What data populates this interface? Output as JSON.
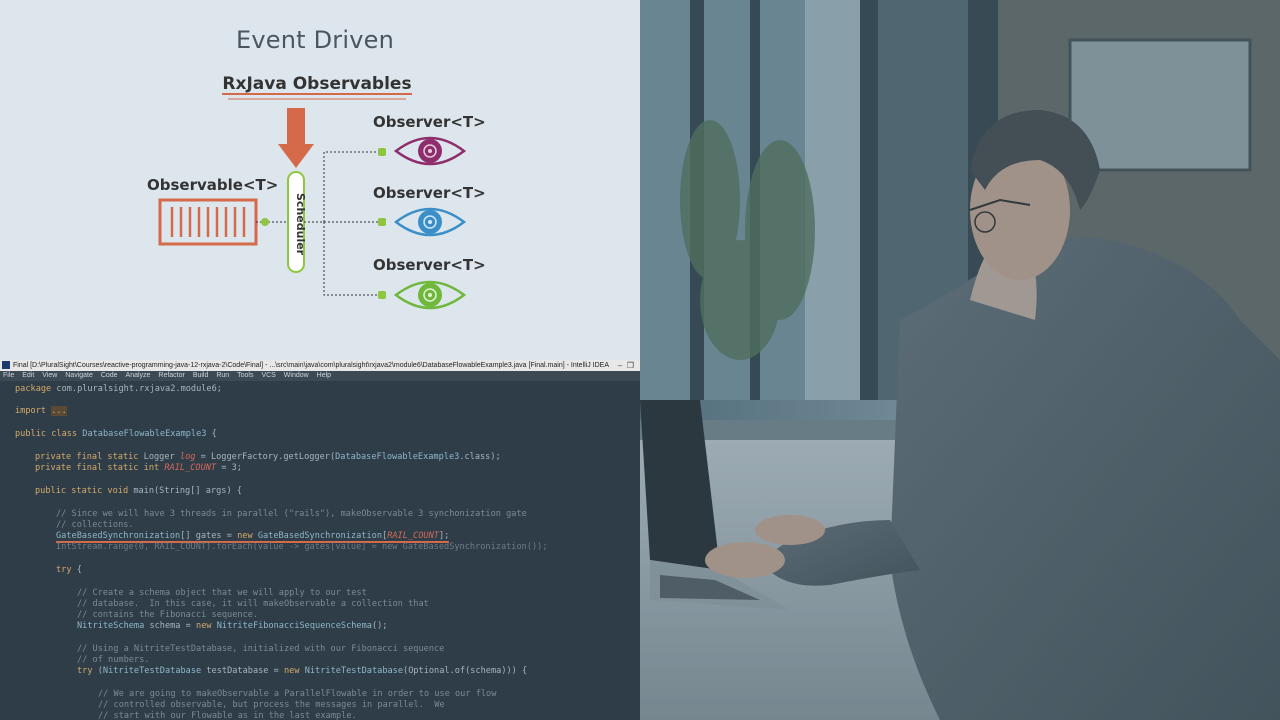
{
  "slide": {
    "title": "Event Driven",
    "subtitle": "RxJava Observables",
    "observable_label": "Observable<T>",
    "scheduler_label": "Scheduler",
    "observers": [
      "Observer<T>",
      "Observer<T>",
      "Observer<T>"
    ],
    "colors": {
      "arrow": "#d46a4a",
      "green": "#8ec63f",
      "purple": "#8e2d6b",
      "blue": "#3a8fc9",
      "green_eye": "#6fb83b"
    }
  },
  "ide": {
    "title": "Final [D:\\PluralSight\\Courses\\reactive-programming-java-12-rxjava-2\\Code\\Final] - ...\\src\\main\\java\\com\\pluralsight\\rxjava2\\module6\\DatabaseFlowableExample3.java [Final.main] - IntelliJ IDEA",
    "menu": [
      "File",
      "Edit",
      "View",
      "Navigate",
      "Code",
      "Analyze",
      "Refactor",
      "Build",
      "Run",
      "Tools",
      "VCS",
      "Window",
      "Help"
    ],
    "code": {
      "l1_kw": "package",
      "l1": " com.pluralsight.rxjava2.module6;",
      "l2_kw": "import",
      "l2": "...",
      "l3_kw": "public class",
      "l3": "DatabaseFlowableExample3",
      "l3b": " {",
      "l4_kw": "private final static",
      "l4a": " Logger ",
      "l4b": "log",
      "l4c": " = LoggerFactory.getLogger(",
      "l4d": "DatabaseFlowableExample3",
      "l4e": ".class);",
      "l5_kw": "private final static int",
      "l5b": " RAIL_COUNT",
      "l5c": " = 3;",
      "l6_kw": "public static void",
      "l6": " main(String[] args) {",
      "c1": "// Since we will have 3 threads in parallel (\"rails\"), makeObservable 3 synchonization gate",
      "c2": "// collections.",
      "l7a": "GateBasedSynchronization",
      "l7b": "[] gates = ",
      "l7kw": "new",
      "l7c": " GateBasedSynchronization",
      "l7d": "[",
      "l7e": "RAIL_COUNT",
      "l7f": "];",
      "l8": "IntStream.range(0, RAIL_COUNT).forEach(value -> gates[value] = new GateBasedSynchronization());",
      "l9_kw": "try",
      "l9": " {",
      "c3": "// Create a schema object that we will apply to our test",
      "c4": "// database.  In this case, it will makeObservable a collection that",
      "c5": "// contains the Fibonacci sequence.",
      "l10a": "NitriteSchema",
      "l10b": " schema = ",
      "l10kw": "new",
      "l10c": " NitriteFibonacciSequenceSchema",
      "l10d": "();",
      "c6": "// Using a NitriteTestDatabase, initialized with our Fibonacci sequence",
      "c7": "// of numbers.",
      "l11kw": "try",
      "l11a": " (",
      "l11b": "NitriteTestDatabase",
      "l11c": " testDatabase = ",
      "l11kw2": "new",
      "l11d": " NitriteTestDatabase",
      "l11e": "(Optional.of(schema))) {",
      "c8": "// We are going to makeObservable a ParallelFlowable in order to use our flow",
      "c9": "// controlled observable, but process the messages in parallel.  We",
      "c10": "// start with our Flowable as in the last example."
    }
  }
}
